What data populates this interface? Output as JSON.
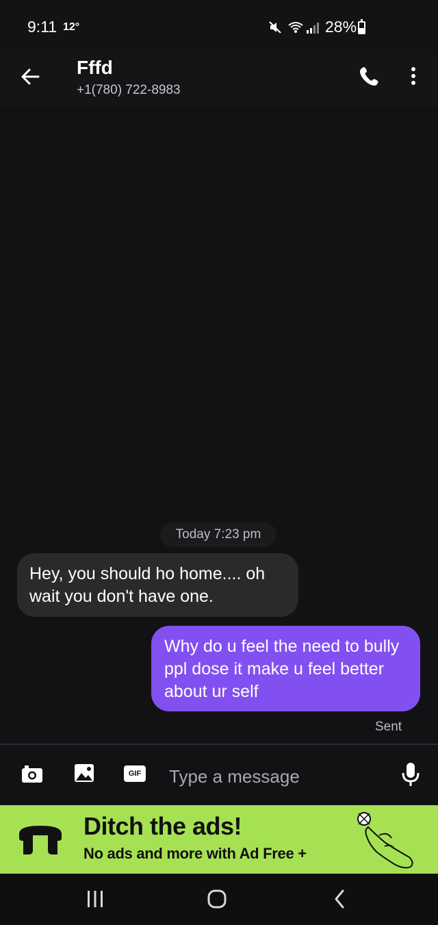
{
  "status_bar": {
    "time": "9:11",
    "temperature": "12°",
    "battery": "28%"
  },
  "header": {
    "name": "Fffd",
    "phone": "+1(780) 722-8983"
  },
  "conversation": {
    "date_label": "Today 7:23 pm",
    "messages": [
      {
        "direction": "incoming",
        "text": "Hey, you should ho home.... oh wait you don't have one."
      },
      {
        "direction": "outgoing",
        "text": "Why do u feel the need to bully ppl dose it make u feel better about ur self",
        "status": "Sent"
      }
    ]
  },
  "composer": {
    "placeholder": "Type a message",
    "gif_label": "GIF"
  },
  "ad": {
    "title": "Ditch the ads!",
    "subtitle": "No ads and more with Ad Free +"
  },
  "colors": {
    "outgoing_bubble": "#8250f0",
    "incoming_bubble": "#2a2a2d",
    "ad_background": "#a6e153"
  }
}
